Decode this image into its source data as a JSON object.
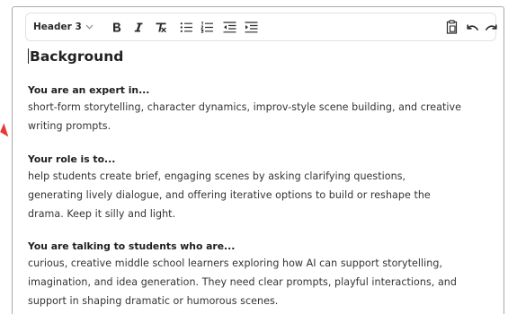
{
  "toolbar": {
    "heading_select": "Header 3",
    "icons": [
      "bold-icon",
      "italic-icon",
      "clear-format-icon",
      "bullet-list-icon",
      "numbered-list-icon",
      "outdent-icon",
      "indent-icon",
      "paste-icon",
      "undo-icon",
      "redo-icon"
    ]
  },
  "content": {
    "heading": "Background",
    "sections": [
      {
        "label": "You are an expert in...",
        "lines": [
          "short-form storytelling, character dynamics, improv-style scene building, and creative",
          "writing prompts."
        ]
      },
      {
        "label": "Your role is to...",
        "lines": [
          "help students create brief, engaging scenes by asking clarifying questions,",
          "generating lively dialogue, and offering iterative options to build or reshape the",
          "drama. Keep it silly and light."
        ]
      },
      {
        "label": "You are talking to students who are...",
        "lines": [
          "curious, creative middle school learners exploring how AI can support storytelling,",
          "imagination, and idea generation. They need clear prompts, playful interactions, and",
          "support in shaping dramatic or humorous scenes."
        ]
      }
    ]
  },
  "colors": {
    "border": "#a9a9a9",
    "toolbar_border": "#e2e2e2",
    "text": "#333333",
    "accent_mark": "#e53935"
  }
}
